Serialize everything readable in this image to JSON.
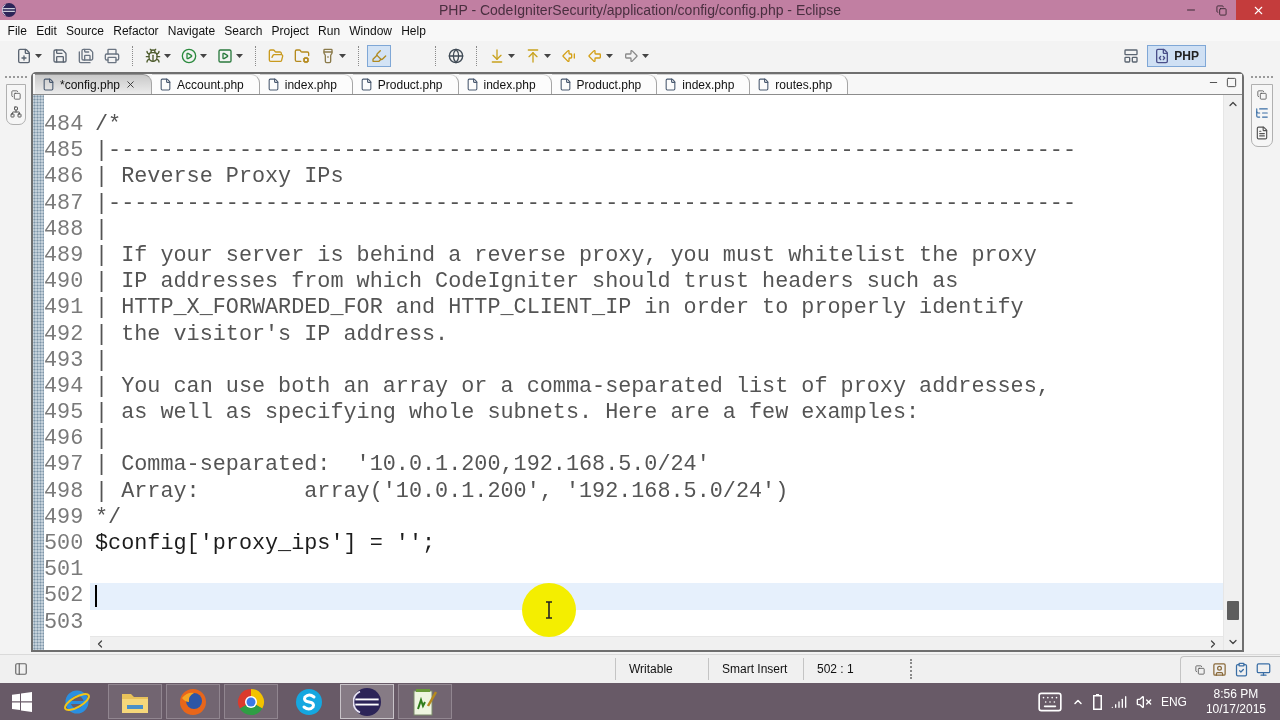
{
  "window": {
    "title": "PHP - CodeIgniterSecurity/application/config/config.php - Eclipse"
  },
  "menu": [
    "File",
    "Edit",
    "Source",
    "Refactor",
    "Navigate",
    "Search",
    "Project",
    "Run",
    "Window",
    "Help"
  ],
  "toolbar": [
    [
      {
        "dropdown": true,
        "selected": false
      },
      {
        "dropdown": false,
        "selected": false
      },
      {
        "dropdown": false,
        "selected": false
      },
      {
        "dropdown": false,
        "selected": false
      }
    ],
    [
      {
        "dropdown": true,
        "selected": false
      },
      {
        "dropdown": true,
        "selected": false
      },
      {
        "dropdown": true,
        "selected": false
      }
    ],
    [
      {
        "dropdown": false,
        "selected": false
      },
      {
        "dropdown": false,
        "selected": false
      },
      {
        "dropdown": true,
        "selected": false
      }
    ],
    [
      {
        "dropdown": false,
        "selected": true
      }
    ],
    [
      {
        "dropdown": false,
        "selected": false
      }
    ],
    [
      {
        "dropdown": true,
        "selected": false
      },
      {
        "dropdown": true,
        "selected": false
      },
      {
        "dropdown": false,
        "selected": false
      },
      {
        "dropdown": true,
        "selected": false
      },
      {
        "dropdown": true,
        "selected": false
      }
    ]
  ],
  "perspectives": [
    {
      "label": "PHP",
      "selected": true
    }
  ],
  "tabs": [
    {
      "label": "*config.php",
      "selected": true
    },
    {
      "label": "Account.php",
      "selected": false
    },
    {
      "label": "index.php",
      "selected": false
    },
    {
      "label": "Product.php",
      "selected": false
    },
    {
      "label": "index.php",
      "selected": false
    },
    {
      "label": "Product.php",
      "selected": false
    },
    {
      "label": "index.php",
      "selected": false
    },
    {
      "label": "routes.php",
      "selected": false
    }
  ],
  "editor": {
    "lines": [
      {
        "number": "484",
        "kind": "comment",
        "text": "/*",
        "current": false
      },
      {
        "number": "485",
        "kind": "comment",
        "text": "|--------------------------------------------------------------------------",
        "current": false
      },
      {
        "number": "486",
        "kind": "comment",
        "text": "| Reverse Proxy IPs",
        "current": false
      },
      {
        "number": "487",
        "kind": "comment",
        "text": "|--------------------------------------------------------------------------",
        "current": false
      },
      {
        "number": "488",
        "kind": "comment",
        "text": "|",
        "current": false
      },
      {
        "number": "489",
        "kind": "comment",
        "text": "| If your server is behind a reverse proxy, you must whitelist the proxy",
        "current": false
      },
      {
        "number": "490",
        "kind": "comment",
        "text": "| IP addresses from which CodeIgniter should trust headers such as",
        "current": false
      },
      {
        "number": "491",
        "kind": "comment",
        "text": "| HTTP_X_FORWARDED_FOR and HTTP_CLIENT_IP in order to properly identify",
        "current": false
      },
      {
        "number": "492",
        "kind": "comment",
        "text": "| the visitor's IP address.",
        "current": false
      },
      {
        "number": "493",
        "kind": "comment",
        "text": "|",
        "current": false
      },
      {
        "number": "494",
        "kind": "comment",
        "text": "| You can use both an array or a comma-separated list of proxy addresses,",
        "current": false
      },
      {
        "number": "495",
        "kind": "comment",
        "text": "| as well as specifying whole subnets. Here are a few examples:",
        "current": false
      },
      {
        "number": "496",
        "kind": "comment",
        "text": "|",
        "current": false
      },
      {
        "number": "497",
        "kind": "comment",
        "text": "| Comma-separated:  '10.0.1.200,192.168.5.0/24'",
        "current": false
      },
      {
        "number": "498",
        "kind": "comment",
        "text": "| Array:        array('10.0.1.200', '192.168.5.0/24')",
        "current": false
      },
      {
        "number": "499",
        "kind": "comment",
        "text": "*/",
        "current": false
      },
      {
        "number": "500",
        "kind": "code",
        "text": "$config['proxy_ips'] = '';",
        "current": false
      },
      {
        "number": "501",
        "current": false
      },
      {
        "number": "502",
        "current": true
      },
      {
        "number": "503",
        "current": false
      }
    ]
  },
  "status_bar": {
    "fields": [
      "Writable",
      "Smart Insert",
      "502 : 1"
    ]
  },
  "taskbar": {
    "apps": [
      {
        "running": false,
        "selected": false
      },
      {
        "running": true,
        "selected": false
      },
      {
        "running": true,
        "selected": false
      },
      {
        "running": true,
        "selected": false
      },
      {
        "running": false,
        "selected": false
      },
      {
        "running": true,
        "selected": true
      },
      {
        "running": true,
        "selected": false
      }
    ],
    "language": "ENG",
    "time": "8:56 PM",
    "date": "10/17/2015"
  }
}
